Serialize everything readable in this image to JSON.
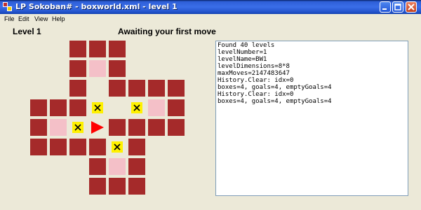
{
  "window": {
    "title": "LP Sokoban# - boxworld.xml - level 1",
    "app_icon": "sokoban-app-icon",
    "controls": [
      "minimize-icon",
      "maximize-icon",
      "close-icon"
    ]
  },
  "menu": {
    "items": [
      {
        "label": "File"
      },
      {
        "label": "Edit"
      },
      {
        "label": "View"
      },
      {
        "label": "Help"
      }
    ]
  },
  "header": {
    "level_label": "Level 1",
    "status": "Awaiting your first move"
  },
  "board": {
    "colors": {
      "wall": "#A52A2A",
      "goal": "#F4C0C8",
      "box": "#FFF100",
      "player": "#FF0000"
    },
    "player_direction": "right",
    "rows": [
      "  ###   ",
      "  #.#   ",
      "  # ####",
      "###$ $.#",
      "#.$@####",
      "####$#  ",
      "   #.#  ",
      "   ###  "
    ]
  },
  "log": {
    "lines": [
      "Found 40 levels",
      "levelNumber=1",
      "levelName=BW1",
      "levelDimensions=8*8",
      "maxMoves=2147483647",
      "History.Clear: idx=0",
      "boxes=4, goals=4, emptyGoals=4",
      "History.Clear: idx=0",
      "boxes=4, goals=4, emptyGoals=4"
    ]
  }
}
